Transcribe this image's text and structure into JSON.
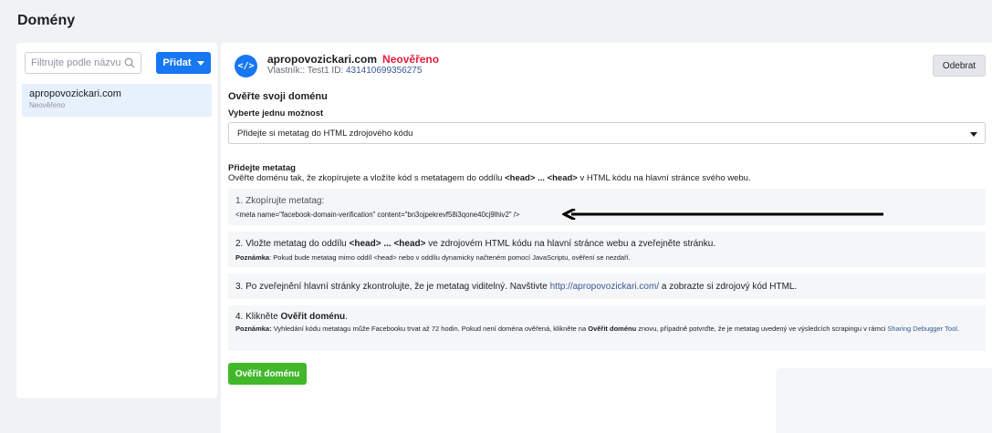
{
  "page": {
    "title": "Domény"
  },
  "sidebar": {
    "search_placeholder": "Filtrujte podle názvu ne...",
    "add_button": "Přidat",
    "domains": [
      {
        "name": "apropovozickari.com",
        "status": "Neověřeno"
      }
    ]
  },
  "header": {
    "domain": "apropovozickari.com",
    "status": "Neověřeno",
    "owner_label": "Vlastník:: Test1",
    "id_label": "ID:",
    "id_value": "431410699356275",
    "remove_button": "Odebrat"
  },
  "verify": {
    "title": "Ověřte svoji doménu",
    "select_label": "Vyberte jednu možnost",
    "selected_option": "Přidejte si metatag do HTML zdrojového kódu"
  },
  "metatag": {
    "title": "Přidejte metatag",
    "desc_pre": "Ověřte doménu tak, že zkopírujete a vložíte kód s metatagem do oddílu ",
    "desc_bold": "<head> ... <head>",
    "desc_post": " v HTML kódu na hlavní stránce svého webu."
  },
  "steps": {
    "step1": {
      "text": "1. Zkopírujte metatag:",
      "code": "<meta name=\"facebook-domain-verification\" content=\"bn3ojpekrevf58i3qone40cj9lhiv2\" />"
    },
    "step2": {
      "text_pre": "2. Vložte metatag do oddílu ",
      "text_bold": "<head> ... <head>",
      "text_post": " ve zdrojovém HTML kódu na hlavní stránce webu a zveřejněte stránku.",
      "note_label": "Poznámka",
      "note_text": ": Pokud bude metatag mimo oddíl <head> nebo v oddílu dynamicky načteném pomocí JavaScriptu, ověření se nezdaří."
    },
    "step3": {
      "text_pre": "3. Po zveřejnění hlavní stránky zkontrolujte, že je metatag viditelný. Navštivte ",
      "link": "http://apropovozickari.com/",
      "text_post": " a zobrazte si zdrojový kód HTML."
    },
    "step4": {
      "text_pre": "4. Klikněte ",
      "text_bold": "Ověřit doménu",
      "text_post": ".",
      "note_label": "Poznámka:",
      "note_text": " Vyhledání kódu metatagu může Facebooku trvat až 72 hodin. Pokud není doména ověřená, klikněte na ",
      "note_bold": "Ověřit doménu",
      "note_text2": " znovu, případně potvrďte, že je metatag uvedený ve výsledcích scrapingu v rámci ",
      "note_link": "Sharing Debugger Tool",
      "note_end": "."
    }
  },
  "verify_button": "Ověřit doménu",
  "colors": {
    "accent": "#1877f2",
    "unverified": "#e41e3f",
    "verify_button": "#42b72a",
    "link": "#385898"
  },
  "icons": {
    "search": "search-icon",
    "domain": "code-icon",
    "caret": "caret-down-icon",
    "arrow": "arrow-left-icon"
  }
}
